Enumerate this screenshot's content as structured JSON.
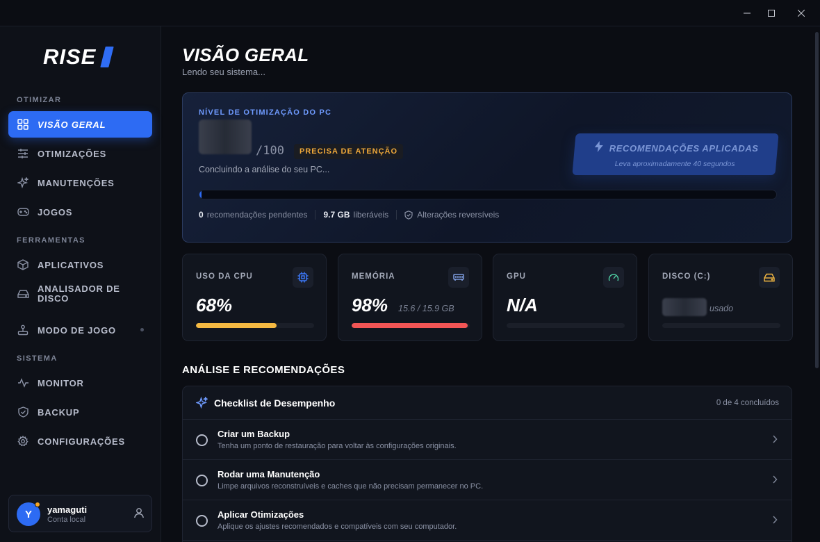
{
  "window": {
    "controls": {
      "minimize": "—",
      "maximize": "☐",
      "close": "✕"
    }
  },
  "logo": {
    "text": "RISE"
  },
  "sidebar": {
    "sections": {
      "optimize": "OTIMIZAR",
      "tools": "FERRAMENTAS",
      "system": "SISTEMA"
    },
    "items": [
      {
        "label": "VISÃO GERAL",
        "icon": "grid-icon",
        "active": true
      },
      {
        "label": "OTIMIZAÇÕES",
        "icon": "sliders-icon"
      },
      {
        "label": "MANUTENÇÕES",
        "icon": "sparkles-icon"
      },
      {
        "label": "JOGOS",
        "icon": "gamepad-icon"
      },
      {
        "label": "APLICATIVOS",
        "icon": "package-icon"
      },
      {
        "label": "ANALISADOR DE\nDISCO",
        "label_line1": "ANALISADOR DE",
        "label_line2": "DISCO",
        "icon": "hard-drive-icon"
      },
      {
        "label": "MODO DE JOGO",
        "icon": "joystick-icon"
      },
      {
        "label": "MONITOR",
        "icon": "activity-icon"
      },
      {
        "label": "BACKUP",
        "icon": "shield-icon"
      },
      {
        "label": "CONFIGURAÇÕES",
        "icon": "gear-icon"
      }
    ],
    "user": {
      "initial": "Y",
      "name": "yamaguti",
      "subtitle": "Conta local",
      "status_color": "#f5a524"
    }
  },
  "main": {
    "title": "VISÃO GERAL",
    "subtitle": "Lendo seu sistema...",
    "hero": {
      "label": "NÍVEL DE OTIMIZAÇÃO DO PC",
      "score_max": "/100",
      "badge": "PRECISA DE ATENÇÃO",
      "status": "Concluindo a análise do seu PC...",
      "progress": 0.004,
      "button_title": "RECOMENDAÇÕES APLICADAS",
      "button_sub": "Leva aproximadamente 40 segundos",
      "stats": {
        "pending_count": "0",
        "pending_label": "recomendações pendentes",
        "free_value": "9.7 GB",
        "free_label": "liberáveis",
        "reversible_label": "Alterações reversíveis"
      }
    },
    "metrics": {
      "cpu": {
        "label": "USO DA CPU",
        "value": "68%",
        "fill": 0.68,
        "color": "#f5b942",
        "icon": "cpu-icon"
      },
      "memory": {
        "label": "MEMÓRIA",
        "value": "98%",
        "extra": "15.6 / 15.9 GB",
        "fill": 0.98,
        "color": "#f25555",
        "icon": "memory-icon"
      },
      "gpu": {
        "label": "GPU",
        "value": "N/A",
        "fill": 0,
        "icon": "gauge-icon"
      },
      "disk": {
        "label": "DISCO (C:)",
        "extra": "usado",
        "fill": 0,
        "icon": "hard-drive-icon"
      }
    },
    "analysis": {
      "title": "ANÁLISE E RECOMENDAÇÕES",
      "checklist_title": "Checklist de Desempenho",
      "checklist_count": "0 de 4 concluídos",
      "rows": [
        {
          "title": "Criar um Backup",
          "desc": "Tenha um ponto de restauração para voltar às configurações originais."
        },
        {
          "title": "Rodar uma Manutenção",
          "desc": "Limpe arquivos reconstruíveis e caches que não precisam permanecer no PC."
        },
        {
          "title": "Aplicar Otimizações",
          "desc": "Aplique os ajustes recomendados e compatíveis com seu computador."
        }
      ]
    }
  }
}
